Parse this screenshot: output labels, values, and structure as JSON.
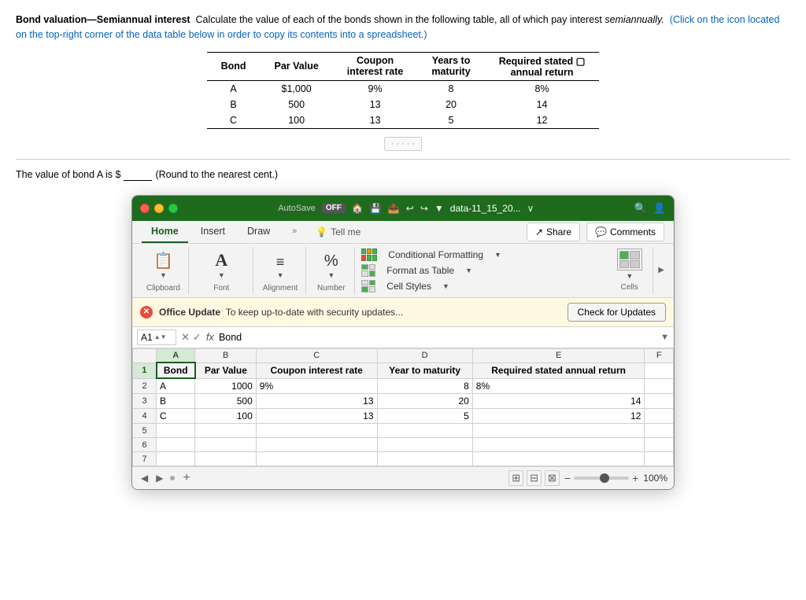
{
  "header": {
    "title": "Bond valuation—Semiannual interest",
    "description": "Calculate the value of each of the bonds shown in the following table, all of which pay interest",
    "description_italic": "semiannually.",
    "instruction": "(Click on the icon located on the top-right corner of the data table below in order to copy its contents into a spreadsheet.)"
  },
  "bond_table": {
    "columns": [
      "Bond",
      "Par Value",
      "Coupon interest rate",
      "Years to maturity",
      "Required stated annual return"
    ],
    "rows": [
      [
        "A",
        "$1,000",
        "9%",
        "8",
        "8%"
      ],
      [
        "B",
        "500",
        "13",
        "20",
        "14"
      ],
      [
        "C",
        "100",
        "13",
        "5",
        "12"
      ]
    ]
  },
  "bond_value_question": {
    "text": "The value of bond A is $",
    "placeholder": "",
    "note": "(Round to the nearest cent.)"
  },
  "excel": {
    "window_title": "data-11_15_20...",
    "autosave_label": "AutoSave",
    "autosave_state": "OFF",
    "tabs": [
      "Home",
      "Insert",
      "Draw",
      "Tell me"
    ],
    "active_tab": "Home",
    "share_label": "Share",
    "comments_label": "Comments",
    "ribbon": {
      "clipboard_label": "Clipboard",
      "font_label": "Font",
      "alignment_label": "Alignment",
      "number_label": "Number",
      "cells_label": "Cells",
      "conditional_formatting": "Conditional Formatting",
      "format_as_table": "Format as Table",
      "cell_styles": "Cell Styles"
    },
    "update_bar": {
      "title": "Office Update",
      "message": "To keep up-to-date with security updates...",
      "button": "Check for Updates"
    },
    "formula_bar": {
      "cell_ref": "A1",
      "formula": "Bond"
    },
    "spreadsheet": {
      "col_headers": [
        "",
        "A",
        "B",
        "C",
        "D",
        "E",
        "F"
      ],
      "rows": [
        [
          "1",
          "Bond",
          "Par Value",
          "Coupon interest rate",
          "Year to maturity",
          "Required stated annual return",
          ""
        ],
        [
          "2",
          "A",
          "1000",
          "9%",
          "8",
          "8%",
          ""
        ],
        [
          "3",
          "B",
          "500",
          "13",
          "20",
          "14",
          ""
        ],
        [
          "4",
          "C",
          "100",
          "13",
          "5",
          "12",
          ""
        ],
        [
          "5",
          "",
          "",
          "",
          "",
          "",
          ""
        ],
        [
          "6",
          "",
          "",
          "",
          "",
          "",
          ""
        ],
        [
          "7",
          "",
          "",
          "",
          "",
          "",
          ""
        ]
      ]
    },
    "zoom": {
      "percent": "100%",
      "value": 100
    }
  }
}
